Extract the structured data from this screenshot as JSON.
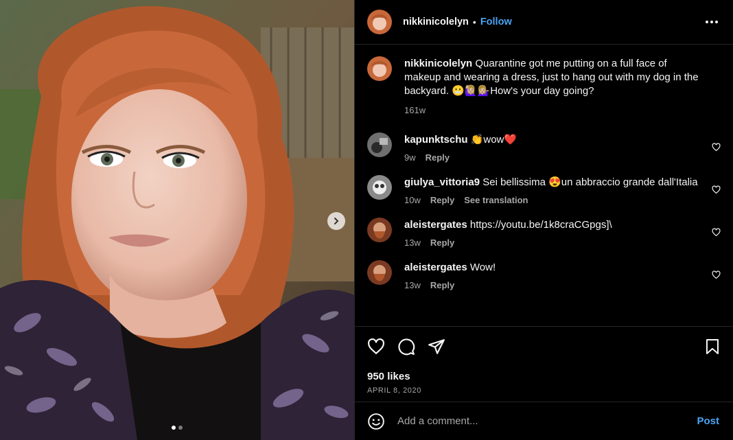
{
  "header": {
    "username": "nikkinicolelyn",
    "separator": "•",
    "follow_label": "Follow",
    "more_icon": "more-horizontal-icon"
  },
  "media": {
    "slide_count": 2,
    "active_slide": 1,
    "next_icon": "chevron-right-icon"
  },
  "caption": {
    "username": "nikkinicolelyn",
    "text": "Quarantine got me putting on a full face of makeup and wearing a dress, just to hang out with my dog in the backyard. 😬🙋🏼‍♀️💁🏼‍♀️How's your day going?",
    "time": "161w"
  },
  "comments": [
    {
      "username": "kapunktschu",
      "text": "👏wow❤️",
      "time": "9w",
      "reply": "Reply",
      "translation": ""
    },
    {
      "username": "giulya_vittoria9",
      "text": "Sei bellissima 😍un abbraccio grande dall'Italia",
      "time": "10w",
      "reply": "Reply",
      "translation": "See translation"
    },
    {
      "username": "aleistergates",
      "text": "https://youtu.be/1k8craCGpgs]\\",
      "time": "13w",
      "reply": "Reply",
      "translation": ""
    },
    {
      "username": "aleistergates",
      "text": "Wow!",
      "time": "13w",
      "reply": "Reply",
      "translation": ""
    }
  ],
  "actions": {
    "like_icon": "heart-icon",
    "comment_icon": "comment-icon",
    "share_icon": "send-icon",
    "save_icon": "bookmark-icon",
    "likes": "950 likes",
    "date": "APRIL 8, 2020"
  },
  "composer": {
    "emoji_icon": "emoji-icon",
    "placeholder": "Add a comment...",
    "post_label": "Post"
  },
  "colors": {
    "background": "#000000",
    "link_blue": "#4aa5f5",
    "secondary_text": "#a8a8a8",
    "divider": "#262626"
  }
}
